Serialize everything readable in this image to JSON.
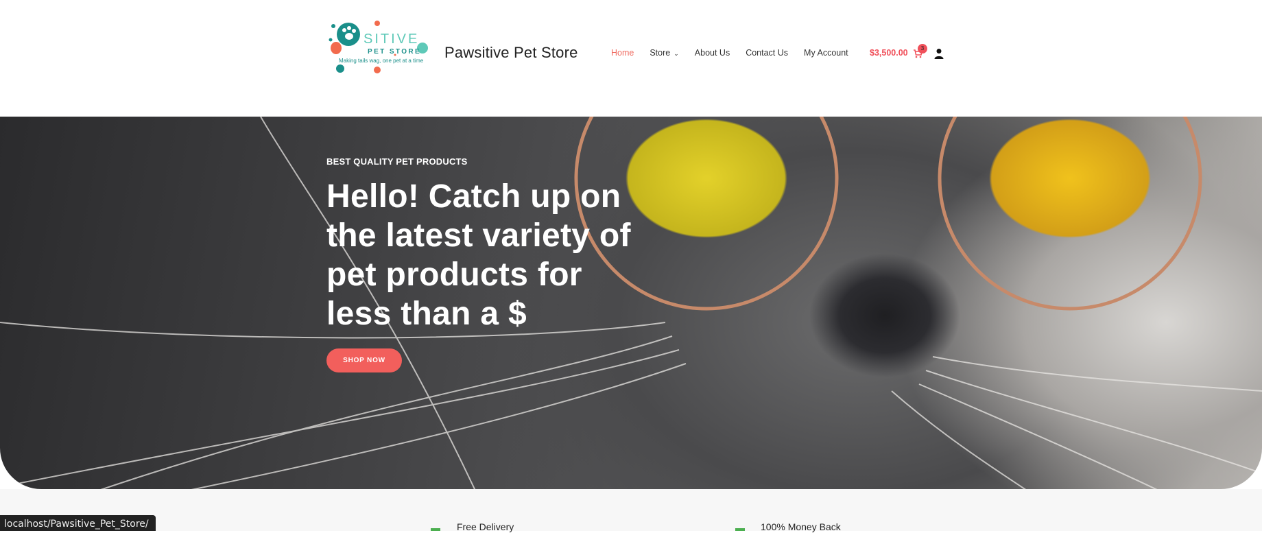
{
  "accessibility": {
    "icon": "accessibility-icon",
    "color": "#4a58b4"
  },
  "logo": {
    "brand_text": "SITIVE",
    "sub_text": "PET STORE",
    "tagline": "Making tails wag, one pet at a time"
  },
  "site_title": "Pawsitive Pet Store",
  "nav": {
    "items": [
      {
        "label": "Home",
        "active": true
      },
      {
        "label": "Store",
        "has_dropdown": true
      },
      {
        "label": "About Us"
      },
      {
        "label": "Contact Us"
      },
      {
        "label": "My Account"
      }
    ]
  },
  "cart": {
    "total": "$3,500.00",
    "count": "3",
    "icon": "cart-icon"
  },
  "user": {
    "icon": "user-icon"
  },
  "hero": {
    "kicker": "BEST QUALITY PET PRODUCTS",
    "title": "Hello! Catch up on the latest variety of pet products for less than a $",
    "button": "SHOP NOW"
  },
  "features": [
    {
      "label": "Free Delivery"
    },
    {
      "label": "100% Money Back"
    }
  ],
  "status_bar": {
    "url": "localhost/Pawsitive_Pet_Store/"
  },
  "colors": {
    "accent": "#f25f5c",
    "price": "#f0505a",
    "nav_active": "#f06a5f"
  }
}
